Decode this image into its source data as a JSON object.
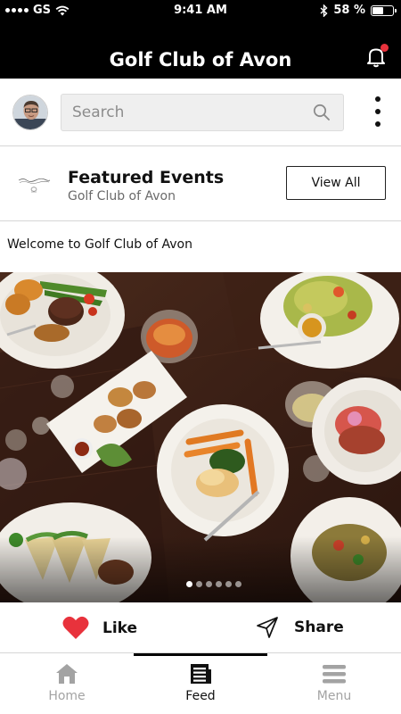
{
  "status_bar": {
    "carrier": "GS",
    "time": "9:41 AM",
    "battery": "58 %",
    "battery_level": 0.58
  },
  "header": {
    "title": "Golf Club of Avon",
    "icons": {
      "notifications": "bell-icon"
    }
  },
  "search": {
    "placeholder": "Search",
    "value": "",
    "icon": "search-icon"
  },
  "featured": {
    "title": "Featured Events",
    "subtitle": "Golf Club of Avon",
    "view_all_label": "View All"
  },
  "welcome_text": "Welcome to Golf Club of Avon",
  "carousel": {
    "slide_count": 6,
    "active_index": 0
  },
  "actions": {
    "like_label": "Like",
    "share_label": "Share"
  },
  "bottom_nav": {
    "items": [
      {
        "label": "Home",
        "icon": "home-icon",
        "active": false
      },
      {
        "label": "Feed",
        "icon": "feed-icon",
        "active": true
      },
      {
        "label": "Menu",
        "icon": "menu-icon",
        "active": false
      }
    ]
  },
  "colors": {
    "header_bg": "#000000",
    "accent_red": "#e8323c",
    "search_bg": "#efefef",
    "inactive_nav": "#a3a3a3"
  }
}
